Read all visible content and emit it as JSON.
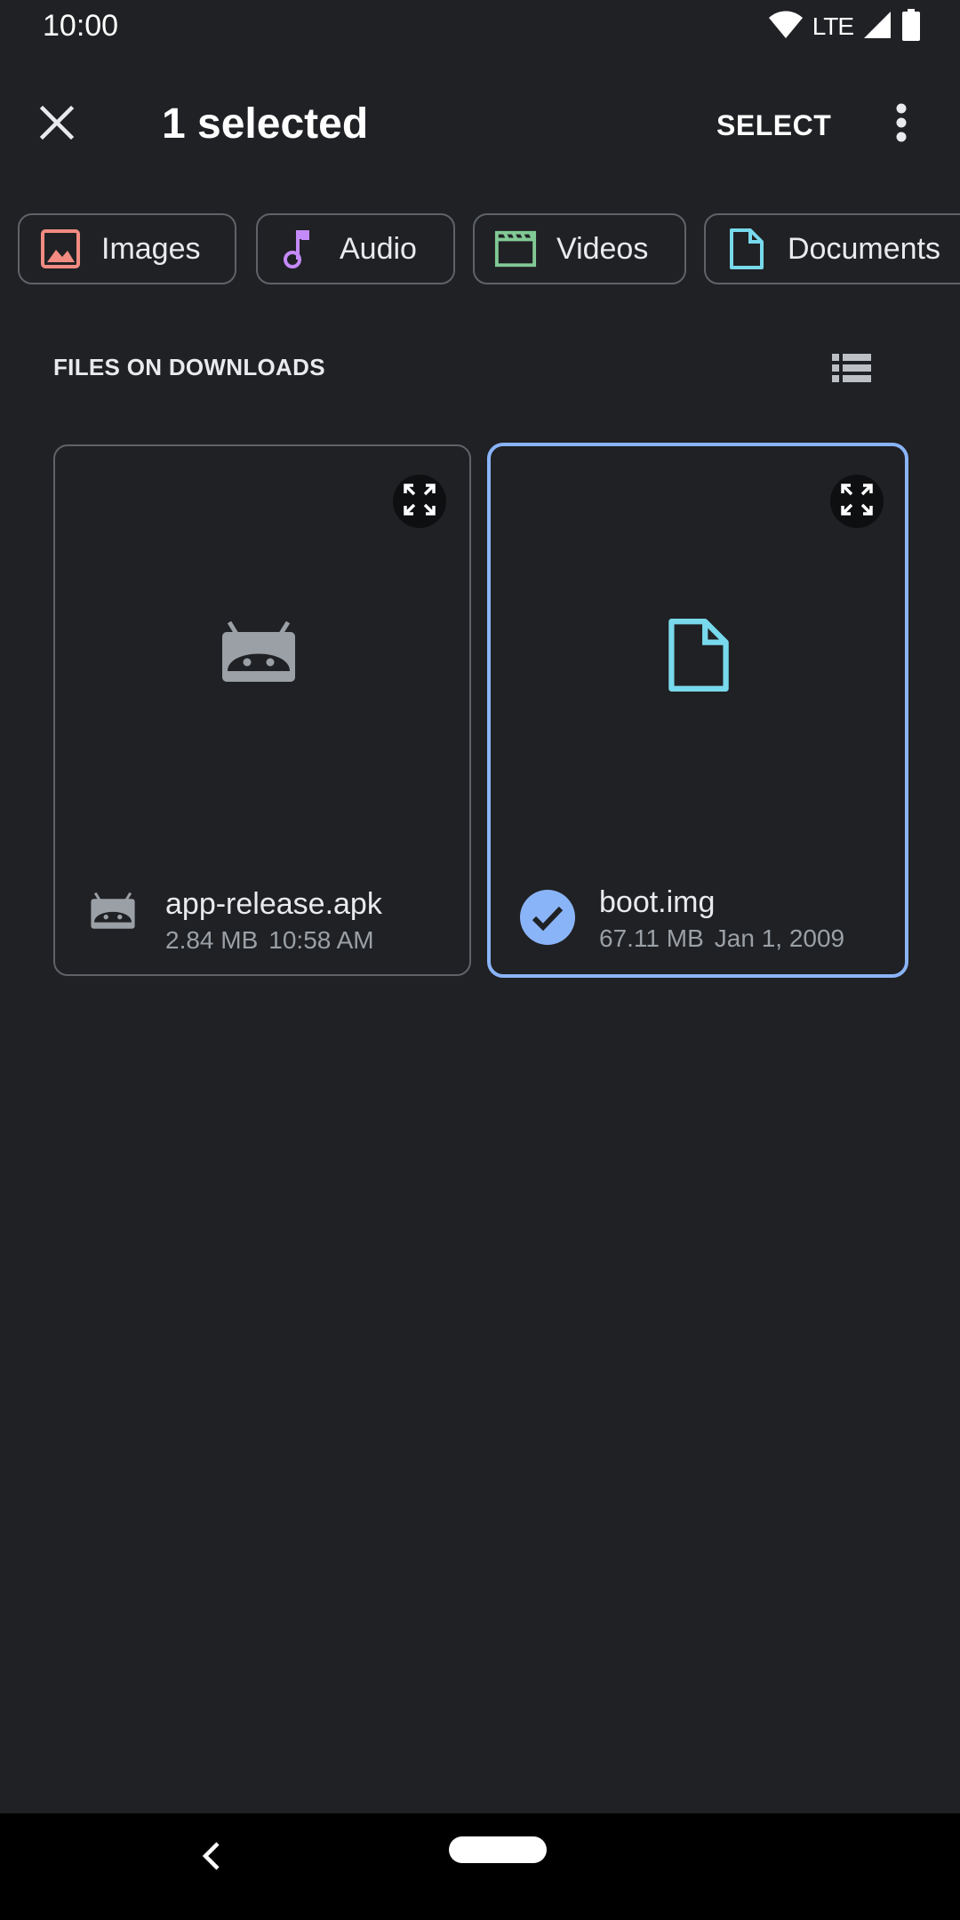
{
  "status_bar": {
    "time": "10:00",
    "network": "LTE",
    "icons": [
      "wifi-icon",
      "signal-icon",
      "battery-icon"
    ]
  },
  "action_bar": {
    "close_icon": "close-icon",
    "title": "1 selected",
    "select_label": "SELECT",
    "more_icon": "more-vert-icon"
  },
  "chips": [
    {
      "label": "Images",
      "icon": "image-icon",
      "color": "#f28b82"
    },
    {
      "label": "Audio",
      "icon": "music-note-icon",
      "color": "#c58af9"
    },
    {
      "label": "Videos",
      "icon": "movie-icon",
      "color": "#81c995"
    },
    {
      "label": "Documents",
      "icon": "document-icon",
      "color": "#78d9ec"
    }
  ],
  "section": {
    "header": "FILES ON DOWNLOADS",
    "view_toggle_icon": "list-view-icon"
  },
  "files": [
    {
      "name": "app-release.apk",
      "size": "2.84 MB",
      "date": "10:58 AM",
      "icon": "android-icon",
      "selected": false
    },
    {
      "name": "boot.img",
      "size": "67.11 MB",
      "date": "Jan 1, 2009",
      "icon": "document-icon",
      "selected": true
    }
  ],
  "colors": {
    "background": "#202124",
    "selected_border": "#8ab4f8",
    "card_border": "#5f6368",
    "secondary_text": "#9aa0a6"
  },
  "nav_bar": {
    "back_icon": "back-icon",
    "home_icon": "home-pill-icon"
  }
}
